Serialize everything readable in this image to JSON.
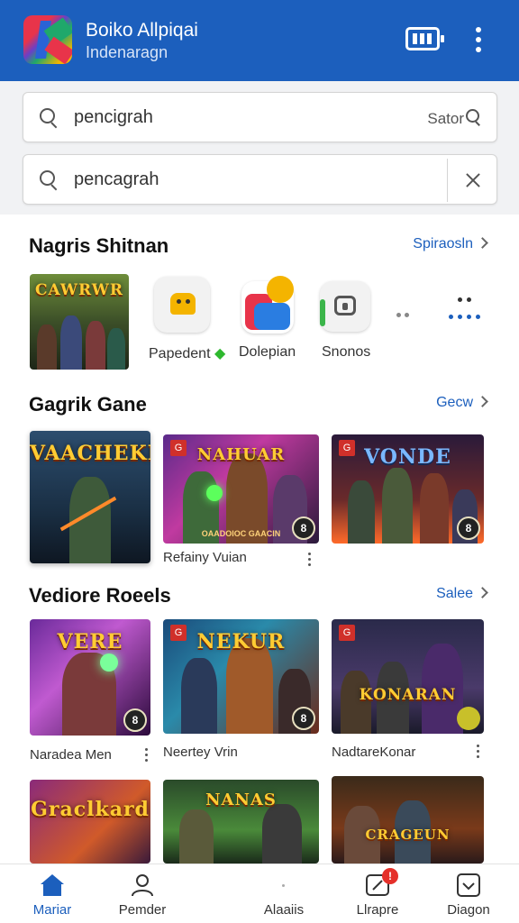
{
  "header": {
    "title": "Boiko Allpiqai",
    "subtitle": "Indenaragn",
    "battery_icon": "battery-icon",
    "more_icon": "more-vert-icon",
    "bg_color": "#1c5fbd"
  },
  "search_primary": {
    "value": "pencigrah",
    "action_label": "Sator"
  },
  "search_secondary": {
    "value": "pencagrah"
  },
  "section1": {
    "title": "Nagris Shitnan",
    "link": "Spiraosln",
    "featured_logo": "CAWRWR",
    "apps": [
      {
        "label": "Papedent",
        "icon": "robot-icon"
      },
      {
        "label": "Dolepian",
        "icon": "smiley-icon"
      },
      {
        "label": "Snonos",
        "icon": "lock-icon"
      }
    ]
  },
  "section2": {
    "title": "Gagrik Gane",
    "link": "Gecw",
    "cards": [
      {
        "logo": "VAACHEKR",
        "caption": ""
      },
      {
        "logo": "NAHUAR",
        "caption": "Refainy Vuian",
        "subtitle": "OAADOIOC GAACIN"
      },
      {
        "logo": "VONDE",
        "caption": ""
      }
    ]
  },
  "section3": {
    "title": "Vediore Roeels",
    "link": "Salee",
    "cards": [
      {
        "logo": "VERE",
        "caption": "Naradea Men"
      },
      {
        "logo": "NEKUR",
        "caption": "Neertey Vrin"
      },
      {
        "logo": "KONARAN",
        "caption": "NadtareKonar"
      }
    ]
  },
  "section4": {
    "cards": [
      {
        "logo": "Graclkard"
      },
      {
        "logo": "NANAS"
      },
      {
        "logo": "CRAGEUN"
      }
    ]
  },
  "bottom_nav": [
    {
      "label": "Mariar",
      "icon": "home-icon",
      "active": true
    },
    {
      "label": "Pemder",
      "icon": "person-icon",
      "active": false
    },
    {
      "label": "Alaaiis",
      "icon": "",
      "active": false
    },
    {
      "label": "Llrapre",
      "icon": "chat-edit-icon",
      "active": false,
      "badge": "!"
    },
    {
      "label": "Diagon",
      "icon": "inbox-icon",
      "active": false
    }
  ]
}
